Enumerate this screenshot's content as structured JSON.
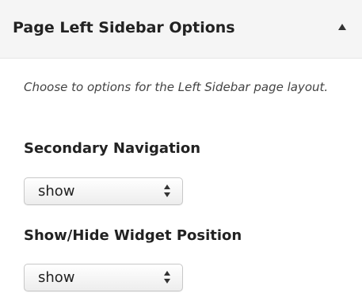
{
  "panel": {
    "title": "Page Left Sidebar Options",
    "toggle_icon": "triangle-up-icon",
    "header_bg": "#f5f5f5"
  },
  "description": "Choose to options for the Left Sidebar page layout.",
  "fields": {
    "secondary_navigation": {
      "label": "Secondary Navigation",
      "value": "show",
      "icon": "select-updown-arrows-icon"
    },
    "widget_position": {
      "label": "Show/Hide Widget Position",
      "value": "show",
      "icon": "select-updown-arrows-icon"
    }
  }
}
